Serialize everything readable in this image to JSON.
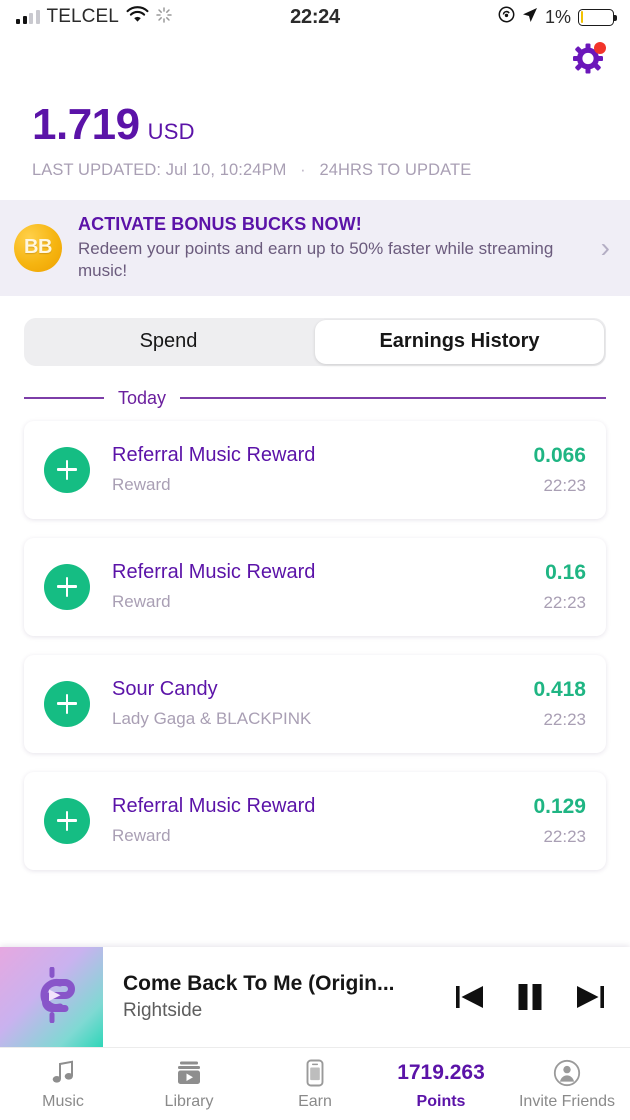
{
  "status_bar": {
    "carrier": "TELCEL",
    "time": "22:24",
    "battery_pct": "1%",
    "icons": [
      "signal-bars-icon",
      "wifi-icon",
      "spinner-icon",
      "rotation-lock-icon",
      "location-arrow-icon",
      "battery-icon"
    ]
  },
  "header": {
    "settings_icon": "gear-icon",
    "notification_badge": true
  },
  "balance": {
    "amount": "1.719",
    "currency": "USD",
    "last_updated": "LAST UPDATED: Jul 10, 10:24PM",
    "separator": "·",
    "update_note": "24HRS TO UPDATE"
  },
  "banner": {
    "badge_text": "BB",
    "title": "ACTIVATE BONUS BUCKS NOW!",
    "subtitle": "Redeem your points and earn up to 50% faster while streaming music!",
    "chevron": "›"
  },
  "tabs": {
    "items": [
      {
        "label": "Spend",
        "active": false
      },
      {
        "label": "Earnings History",
        "active": true
      }
    ]
  },
  "section": {
    "day_label": "Today"
  },
  "transactions": [
    {
      "title": "Referral Music Reward",
      "subtitle": "Reward",
      "amount": "0.066",
      "time": "22:23"
    },
    {
      "title": "Referral Music Reward",
      "subtitle": "Reward",
      "amount": "0.16",
      "time": "22:23"
    },
    {
      "title": "Sour Candy",
      "subtitle": "Lady Gaga & BLACKPINK",
      "amount": "0.418",
      "time": "22:23"
    },
    {
      "title": "Referral Music Reward",
      "subtitle": "Reward",
      "amount": "0.129",
      "time": "22:23"
    }
  ],
  "player": {
    "track_title": "Come Back To Me (Origin...",
    "artist": "Rightside",
    "previous_icon": "skip-previous-icon",
    "play_pause_icon": "pause-icon",
    "next_icon": "skip-next-icon"
  },
  "bottom_nav": [
    {
      "label": "Music",
      "icon": "music-note-icon",
      "active": false
    },
    {
      "label": "Library",
      "icon": "library-play-icon",
      "active": false
    },
    {
      "label": "Earn",
      "icon": "phone-device-icon",
      "active": false
    },
    {
      "label": "Points",
      "icon": "points-value",
      "value": "1719.263",
      "active": true
    },
    {
      "label": "Invite Friends",
      "icon": "person-circle-icon",
      "active": false
    }
  ],
  "colors": {
    "brand_purple": "#5b13a8",
    "accent_green": "#1fb583",
    "muted": "#a99fb4",
    "banner_bg": "#f0eef6",
    "badge_red": "#f2342a",
    "battery_yellow": "#f2c200"
  }
}
